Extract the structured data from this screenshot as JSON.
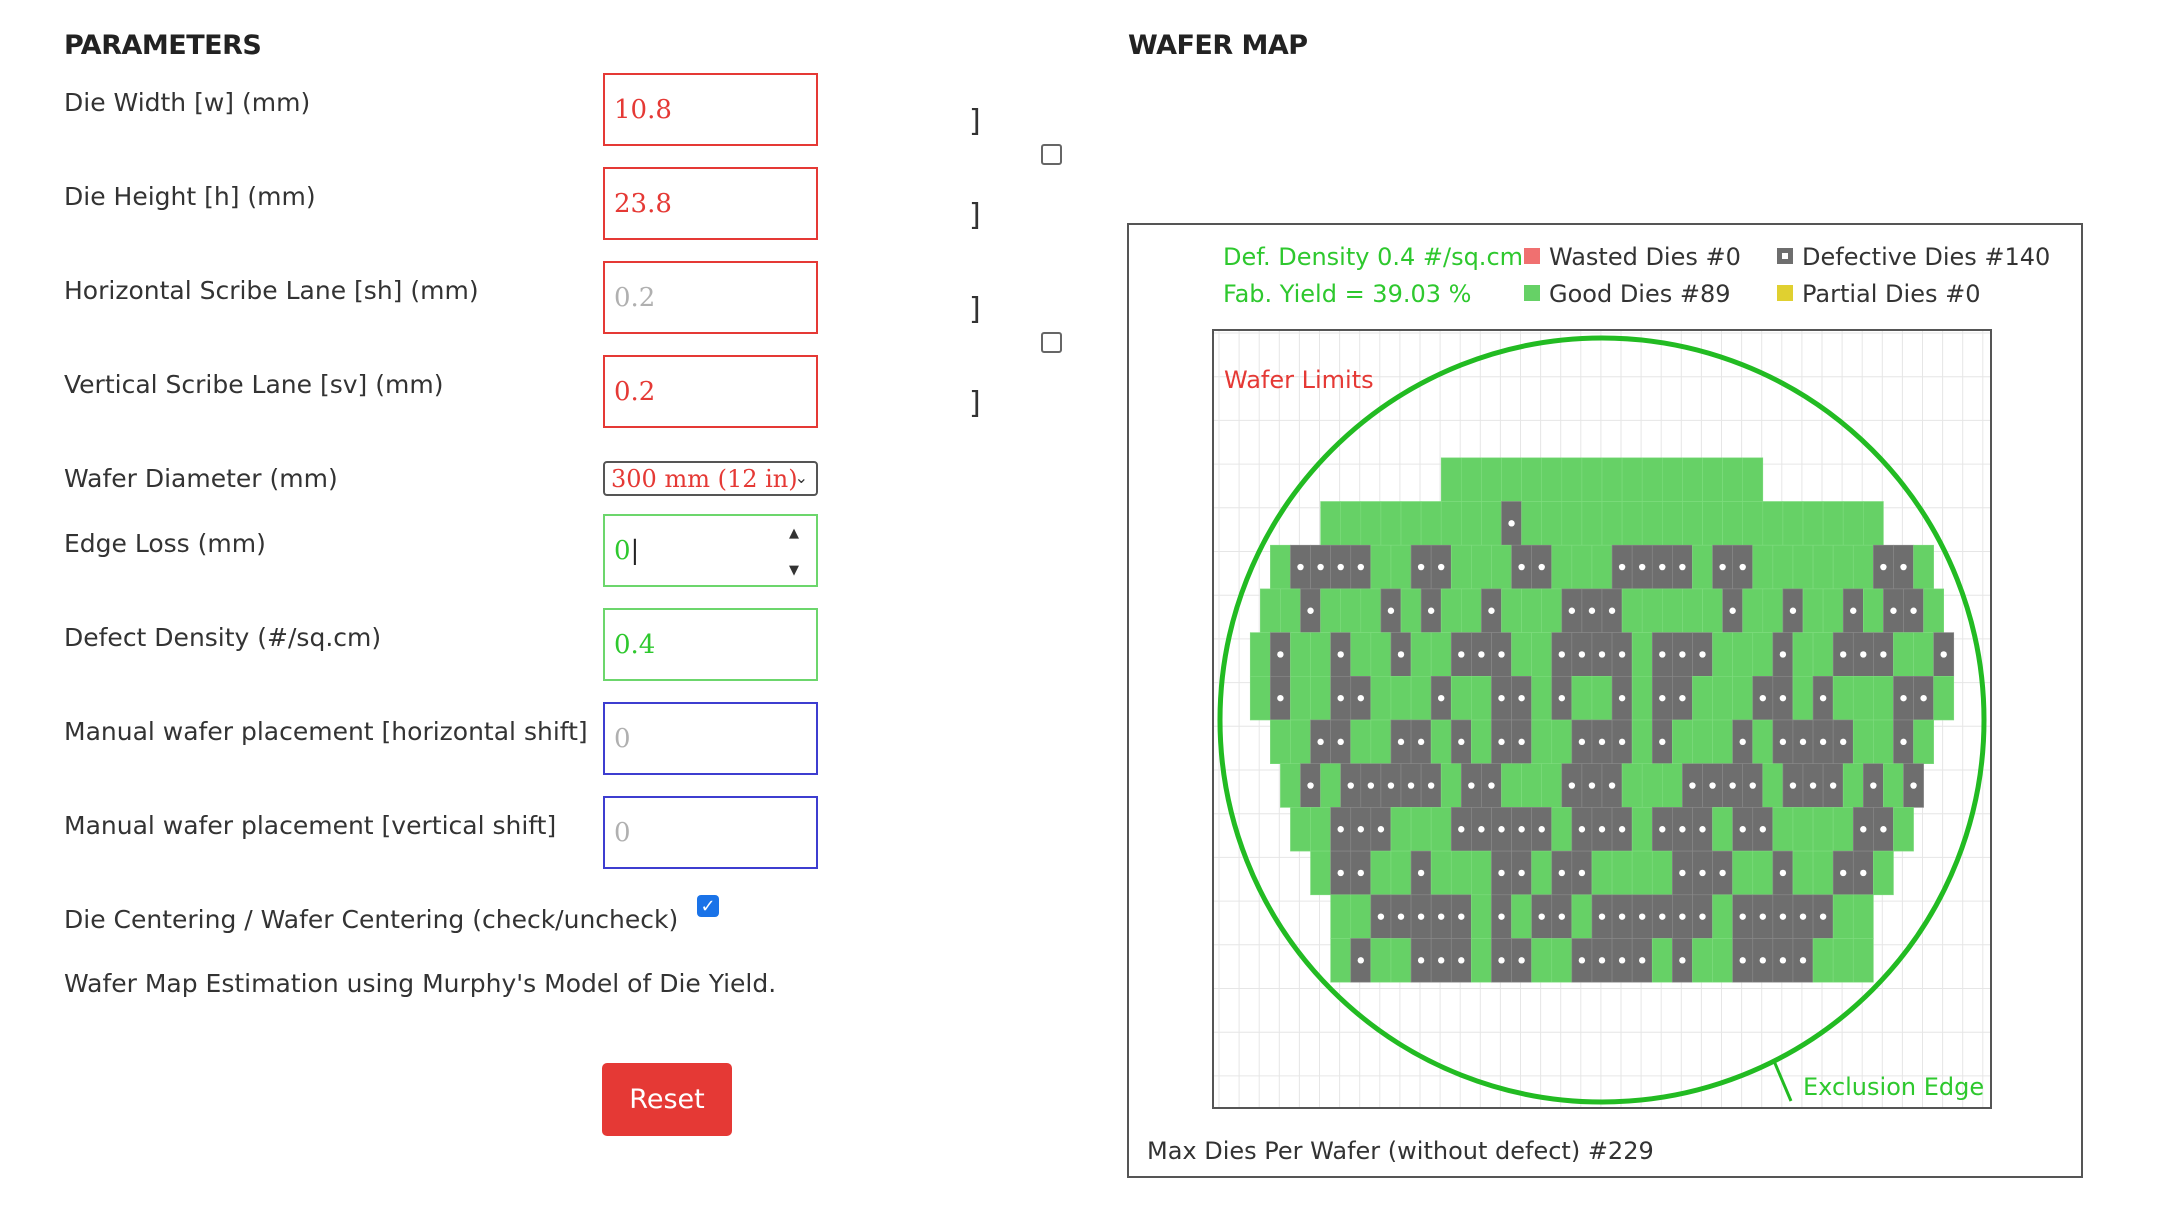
{
  "parameters": {
    "heading": "PARAMETERS",
    "die_width": {
      "label": "Die Width [w] (mm)",
      "value": "10.8"
    },
    "die_height": {
      "label": "Die Height [h] (mm)",
      "value": "23.8"
    },
    "horizontal_scribe": {
      "label": "Horizontal Scribe Lane [sh] (mm)",
      "placeholder": "0.2"
    },
    "vertical_scribe": {
      "label": "Vertical Scribe Lane [sv] (mm)",
      "value": "0.2"
    },
    "wafer_diameter": {
      "label": "Wafer Diameter (mm)",
      "selected": "300 mm (12 in)"
    },
    "edge_loss": {
      "label": "Edge Loss (mm)",
      "value": "0"
    },
    "defect_density": {
      "label": "Defect Density (#/sq.cm)",
      "value": "0.4"
    },
    "h_shift": {
      "label": "Manual wafer placement [horizontal shift]",
      "placeholder": "0"
    },
    "v_shift": {
      "label": "Manual wafer placement [vertical shift]",
      "placeholder": "0"
    },
    "centering": {
      "label": "Die Centering / Wafer Centering (check/uncheck)",
      "checked": true
    },
    "description": "Wafer Map Estimation using Murphy's Model of Die Yield.",
    "reset_label": "Reset",
    "bracket_glyph": "]"
  },
  "wafer_map": {
    "heading": "WAFER MAP",
    "def_density": "Def. Density 0.4 #/sq.cm",
    "fab_yield": "Fab. Yield = 39.03 %",
    "wasted": "Wasted Dies  #0",
    "good": "Good Dies #89",
    "defective": "Defective Dies  #140",
    "partial": "Partial Dies #0",
    "wafer_limits": "Wafer Limits",
    "exclusion_edge": "Exclusion Edge",
    "max_dies": "Max Dies Per Wafer (without defect) #229",
    "colors": {
      "good": "#66d166",
      "defective": "#6e6e6e",
      "wasted": "#f07070",
      "partial": "#e0d030",
      "circle": "#22bb22",
      "label_red": "#e53935",
      "label_green": "#2ec82e"
    },
    "rows": [
      "GGGGGGGGGGGGGGGG",
      "GGGGGGGGGDGGGGGGGGGGGGGGGGGG",
      "GDDDDGGDDGGGDDGGGDDDDGDDGGGGGGDDG",
      "GGDGGGDGDGGDGGGDDDGGGGGDGGDGGDGDDG",
      "GDGGDGGDGGDDDGGDDDDGDDDGGGDGGDDDGGD",
      "GDGGDDGGGDGGDDGDGGDGDDGGGDDGDGGGDDG",
      "GGDDGGDDGDGDDGGDDDGDGGGDGDDDDGGDG",
      "GDGDDDDDGDDGGGDDDGGGDDDDGDDDGDGD",
      "GGDDDGGGDDDDDGDDDGDDDGDDGGGGDDG",
      "GDDGGDGGGDDGDDGGGGDDDGGDGGDDG",
      "GGDDDDDGDGDDGDDDDDDGDDDDDGG",
      "GDGGDDDGDDGGDDDDGDGGDDDDGGG"
    ]
  }
}
